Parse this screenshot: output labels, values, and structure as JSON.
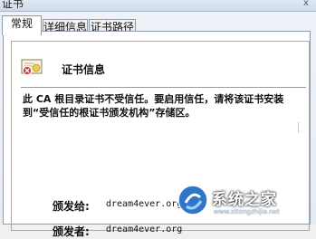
{
  "window": {
    "title": "证书",
    "close_glyph": "x"
  },
  "tabs": [
    {
      "label": "常规",
      "active": true
    },
    {
      "label": "详细信息",
      "active": false
    },
    {
      "label": "证书路径",
      "active": false
    }
  ],
  "cert_info": {
    "title": "证书信息",
    "warning": "此 CA 根目录证书不受信任。要启用信任，请将该证书安装到“受信任的根证书颁发机构”存储区。"
  },
  "fields": {
    "issued_to_label": "颁发给:",
    "issued_to_value": "dream4ever.org",
    "issued_by_label": "颁发者:",
    "issued_by_value": "dream4ever.org"
  },
  "watermark": {
    "brand": "系统之家",
    "url": "www.xitongzhijia.net"
  },
  "icons": {
    "certificate": "certificate-warning-icon",
    "close": "close-icon",
    "logo": "site-logo-icon"
  },
  "colors": {
    "tab_active_bg": "#ffffff",
    "panel_border": "#8e9aa8",
    "title_bar": "#dfe8f3",
    "cert_error": "#d22b2b",
    "logo_blue": "#2f76c9"
  }
}
